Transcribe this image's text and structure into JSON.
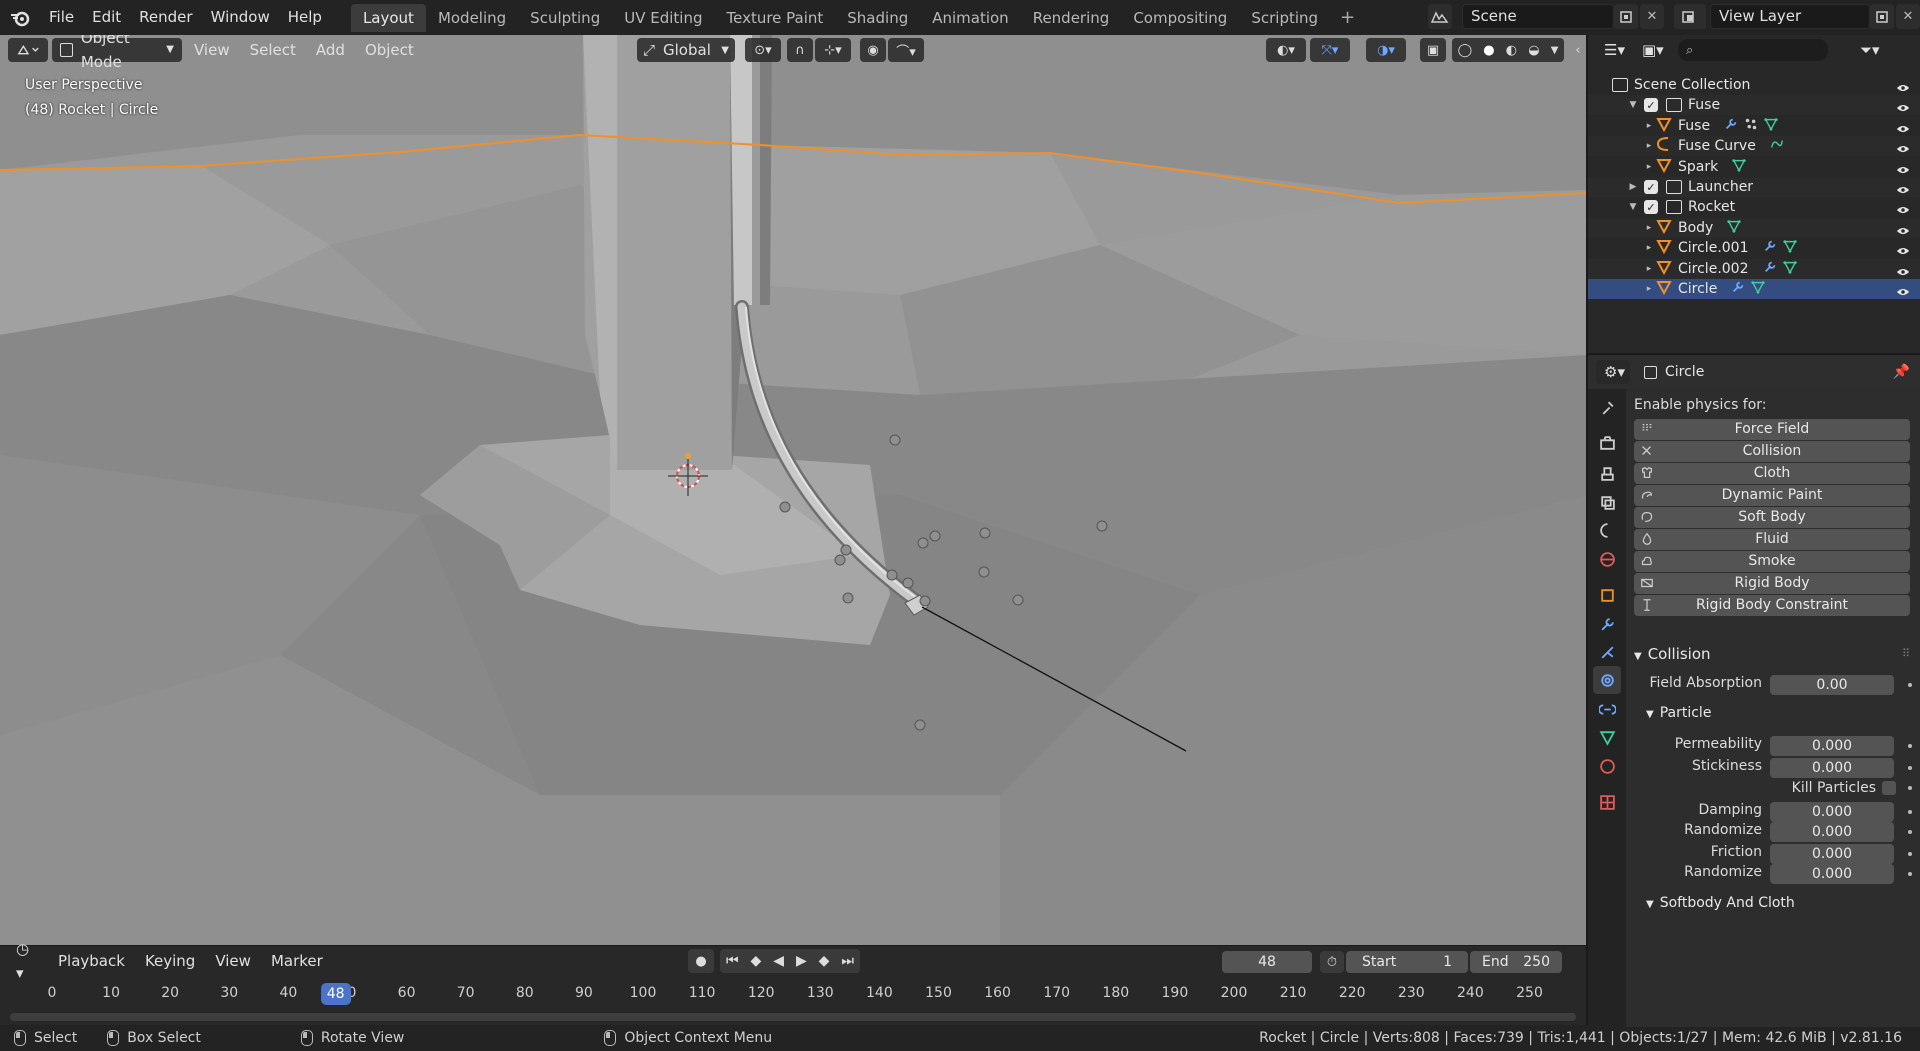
{
  "topbar": {
    "menus": [
      "File",
      "Edit",
      "Render",
      "Window",
      "Help"
    ],
    "workspaces": [
      "Layout",
      "Modeling",
      "Sculpting",
      "UV Editing",
      "Texture Paint",
      "Shading",
      "Animation",
      "Rendering",
      "Compositing",
      "Scripting"
    ],
    "active_workspace": "Layout",
    "add_workspace": "+",
    "scene": "Scene",
    "view_layer": "View Layer"
  },
  "viewport": {
    "mode": "Object Mode",
    "menus": [
      "View",
      "Select",
      "Add",
      "Object"
    ],
    "orientation": "Global",
    "overlay_line1": "User Perspective",
    "overlay_line2": "(48) Rocket | Circle",
    "selection_color": "#f0902a"
  },
  "timeline": {
    "menus": [
      "Playback",
      "Keying",
      "View",
      "Marker"
    ],
    "current_frame": "48",
    "start_label": "Start",
    "start_value": "1",
    "end_label": "End",
    "end_value": "250",
    "ticks": [
      "0",
      "10",
      "20",
      "30",
      "40",
      "50",
      "60",
      "70",
      "80",
      "90",
      "100",
      "110",
      "120",
      "130",
      "140",
      "150",
      "160",
      "170",
      "180",
      "190",
      "200",
      "210",
      "220",
      "230",
      "240",
      "250"
    ],
    "accent": "#4a73c9"
  },
  "statusbar": {
    "select": "Select",
    "box_select": "Box Select",
    "rotate_view": "Rotate View",
    "context_menu": "Object Context Menu",
    "stats": "Rocket | Circle | Verts:808 | Faces:739 | Tris:1,441 | Objects:1/27 | Mem: 42.6 MiB | v2.81.16"
  },
  "outliner": {
    "search_placeholder": "",
    "rows": [
      {
        "name": "Scene Collection",
        "kind": "scene-collection"
      },
      {
        "name": "Fuse",
        "kind": "collection",
        "expanded": true
      },
      {
        "name": "Fuse",
        "kind": "mesh",
        "extras": [
          "wrench-icon",
          "particles-icon",
          "mesh-data-icon"
        ]
      },
      {
        "name": "Fuse Curve",
        "kind": "curve",
        "extras": [
          "curve-data-icon"
        ]
      },
      {
        "name": "Spark",
        "kind": "mesh",
        "extras": [
          "mesh-data-icon"
        ]
      },
      {
        "name": "Launcher",
        "kind": "collection",
        "expanded": false
      },
      {
        "name": "Rocket",
        "kind": "collection",
        "expanded": true
      },
      {
        "name": "Body",
        "kind": "mesh",
        "extras": [
          "mesh-data-icon"
        ]
      },
      {
        "name": "Circle.001",
        "kind": "mesh",
        "extras": [
          "wrench-icon",
          "mesh-data-icon"
        ]
      },
      {
        "name": "Circle.002",
        "kind": "mesh",
        "extras": [
          "wrench-icon",
          "mesh-data-icon"
        ]
      },
      {
        "name": "Circle",
        "kind": "mesh",
        "selected": true,
        "extras": [
          "wrench-icon",
          "mesh-data-icon"
        ]
      }
    ]
  },
  "properties": {
    "object_name": "Circle",
    "enable_physics_label": "Enable physics for:",
    "physics_buttons": [
      {
        "label": "Force Field",
        "icon": "force-field-icon"
      },
      {
        "label": "Collision",
        "icon": "collision-icon"
      },
      {
        "label": "Cloth",
        "icon": "cloth-icon"
      },
      {
        "label": "Dynamic Paint",
        "icon": "dynamic-paint-icon"
      },
      {
        "label": "Soft Body",
        "icon": "soft-body-icon"
      },
      {
        "label": "Fluid",
        "icon": "fluid-icon"
      },
      {
        "label": "Smoke",
        "icon": "smoke-icon"
      },
      {
        "label": "Rigid Body",
        "icon": "rigid-body-icon"
      },
      {
        "label": "Rigid Body Constraint",
        "icon": "rigid-body-constraint-icon"
      }
    ],
    "collision_title": "Collision",
    "field_absorption_label": "Field Absorption",
    "field_absorption_value": "0.00",
    "particle_title": "Particle",
    "permeability_label": "Permeability",
    "permeability_value": "0.000",
    "stickiness_label": "Stickiness",
    "stickiness_value": "0.000",
    "kill_particles_label": "Kill Particles",
    "damping_label": "Damping",
    "damping_value": "0.000",
    "randomize_label": "Randomize",
    "randomize_value": "0.000",
    "friction_label": "Friction",
    "friction_value": "0.000",
    "randomize2_label": "Randomize",
    "randomize2_value": "0.000",
    "softbody_title": "Softbody And Cloth"
  }
}
